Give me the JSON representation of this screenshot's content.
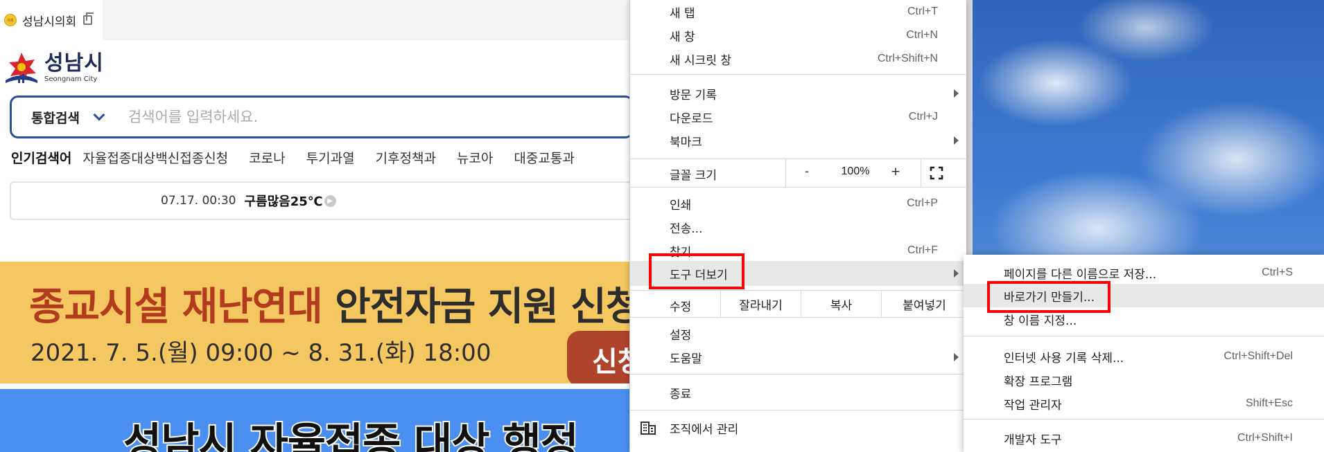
{
  "browser": {
    "tab_title": "성남시의회",
    "tab_favicon_text": "의회"
  },
  "page": {
    "logo_kr": "성남시",
    "logo_en": "Seongnam City",
    "search": {
      "scope": "통합검색",
      "placeholder": "검색어를 입력하세요."
    },
    "popular": {
      "label": "인기검색어",
      "keywords": [
        "자율접종대상백신접종신청",
        "코로나",
        "투기과열",
        "기후정책과",
        "뉴코아",
        "대중교통과"
      ]
    },
    "weather": {
      "date": "07.17. 00:30",
      "desc": "구름많음25℃"
    },
    "banner1": {
      "title_red": "종교시설 재난연대",
      "title_dark": " 안전자금 지원 신청",
      "date": "2021. 7. 5.(월) 09:00 ~ 8. 31.(화) 18:00",
      "button": "신청하기"
    },
    "banner2": {
      "title": "성남시 자율접종 대상 행정"
    }
  },
  "menu": {
    "new_tab": {
      "label": "새 탭",
      "shortcut": "Ctrl+T"
    },
    "new_window": {
      "label": "새 창",
      "shortcut": "Ctrl+N"
    },
    "incognito": {
      "label": "새 시크릿 창",
      "shortcut": "Ctrl+Shift+N"
    },
    "history": {
      "label": "방문 기록"
    },
    "downloads": {
      "label": "다운로드",
      "shortcut": "Ctrl+J"
    },
    "bookmarks": {
      "label": "북마크"
    },
    "zoom": {
      "label": "글꼴 크기",
      "minus": "-",
      "value": "100%",
      "plus": "+"
    },
    "print": {
      "label": "인쇄",
      "shortcut": "Ctrl+P"
    },
    "cast": {
      "label": "전송..."
    },
    "find": {
      "label": "찾기",
      "shortcut": "Ctrl+F"
    },
    "more_tools": {
      "label": "도구 더보기"
    },
    "edit": {
      "label": "수정",
      "cut": "잘라내기",
      "copy": "복사",
      "paste": "붙여넣기"
    },
    "settings": {
      "label": "설정"
    },
    "help": {
      "label": "도움말"
    },
    "exit": {
      "label": "종료"
    },
    "managed": {
      "label": "조직에서 관리"
    }
  },
  "submenu": {
    "save_as": {
      "label": "페이지를 다른 이름으로 저장...",
      "shortcut": "Ctrl+S"
    },
    "create_shortcut": {
      "label": "바로가기 만들기..."
    },
    "name_window": {
      "label": "창 이름 지정..."
    },
    "clear_data": {
      "label": "인터넷 사용 기록 삭제...",
      "shortcut": "Ctrl+Shift+Del"
    },
    "extensions": {
      "label": "확장 프로그램"
    },
    "task_manager": {
      "label": "작업 관리자",
      "shortcut": "Shift+Esc"
    },
    "dev_tools": {
      "label": "개발자 도구",
      "shortcut": "Ctrl+Shift+I"
    }
  },
  "colors": {
    "highlight_box": "#ff0000",
    "search_border": "#2b4f9e",
    "banner1_bg": "#f4c760",
    "banner2_bg": "#4a8ef0"
  }
}
